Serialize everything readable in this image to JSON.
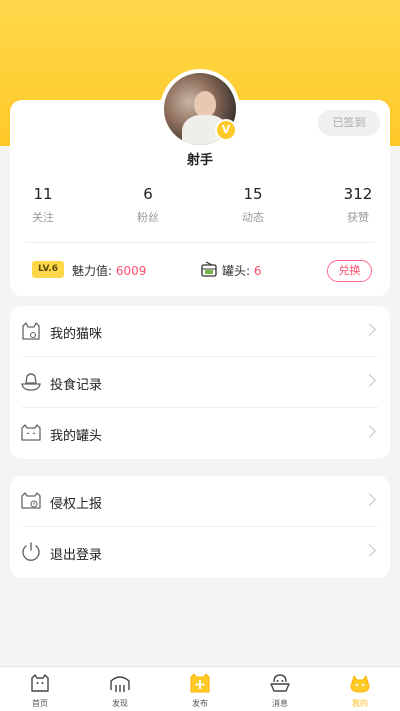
{
  "profile": {
    "username": "射手",
    "checkin_label": "已签到",
    "verified_mark": "V",
    "avatar_icon": "user-avatar"
  },
  "stats": [
    {
      "value": "11",
      "label": "关注"
    },
    {
      "value": "6",
      "label": "粉丝"
    },
    {
      "value": "15",
      "label": "动态"
    },
    {
      "value": "312",
      "label": "获赞"
    }
  ],
  "level": {
    "badge": "LV.6",
    "charm_label": "魅力值:",
    "charm_value": "6009",
    "cans_label": "罐头:",
    "cans_value": "6",
    "exchange_label": "兑换"
  },
  "menu_group_1": [
    {
      "label": "我的猫咪",
      "icon": "cat-icon"
    },
    {
      "label": "投食记录",
      "icon": "feed-bowl-icon"
    },
    {
      "label": "我的罐头",
      "icon": "can-icon"
    }
  ],
  "menu_group_2": [
    {
      "label": "侵权上报",
      "icon": "report-icon"
    },
    {
      "label": "退出登录",
      "icon": "power-icon"
    }
  ],
  "tabs": [
    {
      "label": "首页",
      "icon": "home-cat-icon"
    },
    {
      "label": "发现",
      "icon": "discover-icon"
    },
    {
      "label": "发布",
      "icon": "publish-icon"
    },
    {
      "label": "消息",
      "icon": "message-icon"
    },
    {
      "label": "我的",
      "icon": "profile-cat-icon",
      "active": true
    }
  ],
  "colors": {
    "accent_yellow": "#ffc928",
    "accent_pink": "#ff4d6d",
    "background": "#f4f4f5"
  }
}
